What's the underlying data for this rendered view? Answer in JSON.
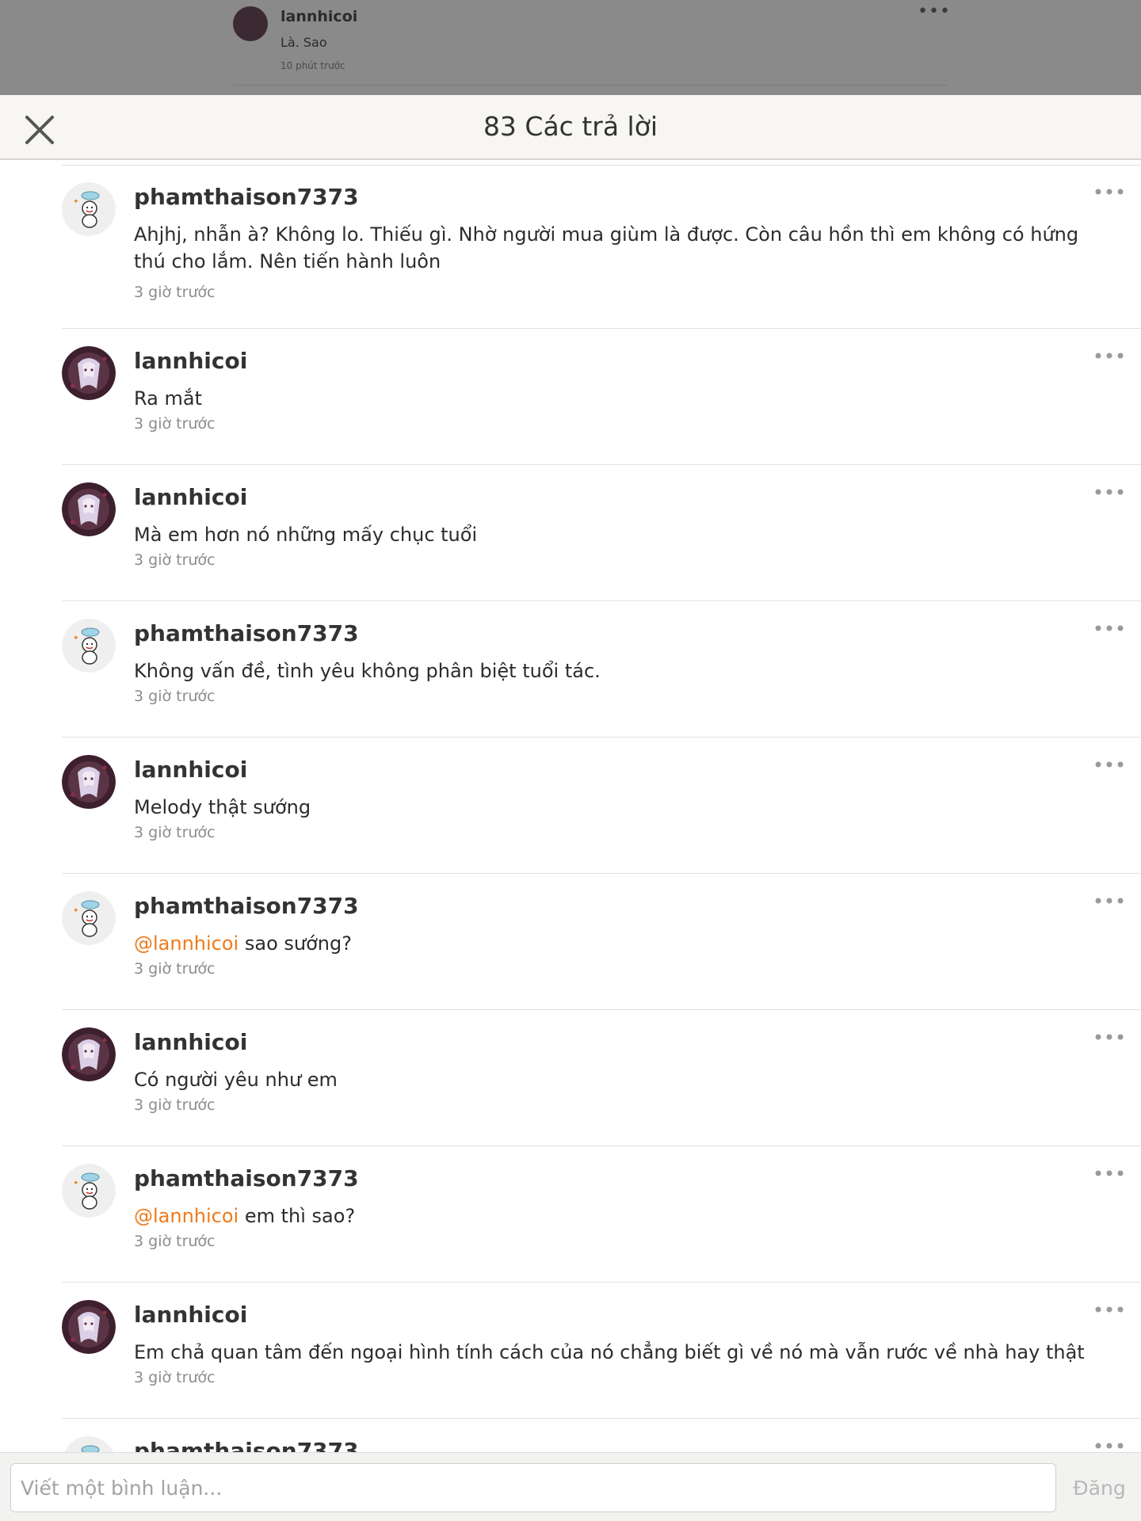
{
  "background_post": {
    "username": "lannhicoi",
    "text": "Là. Sao",
    "time": "10 phút trước"
  },
  "header": {
    "title": "83 Các trả lời"
  },
  "comments": [
    {
      "username": "phamthaison7373",
      "avatar": "snowman",
      "mention": "",
      "text": "Ahjhj, nhẫn à? Không lo. Thiếu gì. Nhờ người mua giùm là được. Còn câu hồn thì em không có hứng thú cho lắm. Nên tiến hành luôn",
      "time": "3 giờ trước"
    },
    {
      "username": "lannhicoi",
      "avatar": "anime",
      "mention": "",
      "text": "Ra mắt",
      "time": "3 giờ trước"
    },
    {
      "username": "lannhicoi",
      "avatar": "anime",
      "mention": "",
      "text": "Mà em hơn nó những mấy chục tuổi",
      "time": "3 giờ trước"
    },
    {
      "username": "phamthaison7373",
      "avatar": "snowman",
      "mention": "",
      "text": "Không vấn đề, tình yêu không phân biệt tuổi tác.",
      "time": "3 giờ trước"
    },
    {
      "username": "lannhicoi",
      "avatar": "anime",
      "mention": "",
      "text": "Melody thật sướng",
      "time": "3 giờ trước"
    },
    {
      "username": "phamthaison7373",
      "avatar": "snowman",
      "mention": "@lannhicoi",
      "text": " sao sướng?",
      "time": "3 giờ trước"
    },
    {
      "username": "lannhicoi",
      "avatar": "anime",
      "mention": "",
      "text": "Có người yêu như em",
      "time": "3 giờ trước"
    },
    {
      "username": "phamthaison7373",
      "avatar": "snowman",
      "mention": "@lannhicoi",
      "text": " em thì sao?",
      "time": "3 giờ trước"
    },
    {
      "username": "lannhicoi",
      "avatar": "anime",
      "mention": "",
      "text": "Em chả quan tâm đến ngoại hình tính cách của nó chẳng biết gì về nó mà vẫn rước về nhà hay thật",
      "time": "3 giờ trước"
    },
    {
      "username": "phamthaison7373",
      "avatar": "snowman",
      "mention": "",
      "text": "",
      "time": ""
    }
  ],
  "composer": {
    "placeholder": "Viết một bình luận...",
    "post_label": "Đăng"
  },
  "icons": {
    "close": "close-icon",
    "more": "more-dots-icon"
  },
  "colors": {
    "mention": "#ef7a1a",
    "header_bg": "#f7f6f2",
    "overlay": "#8a8a8a"
  }
}
